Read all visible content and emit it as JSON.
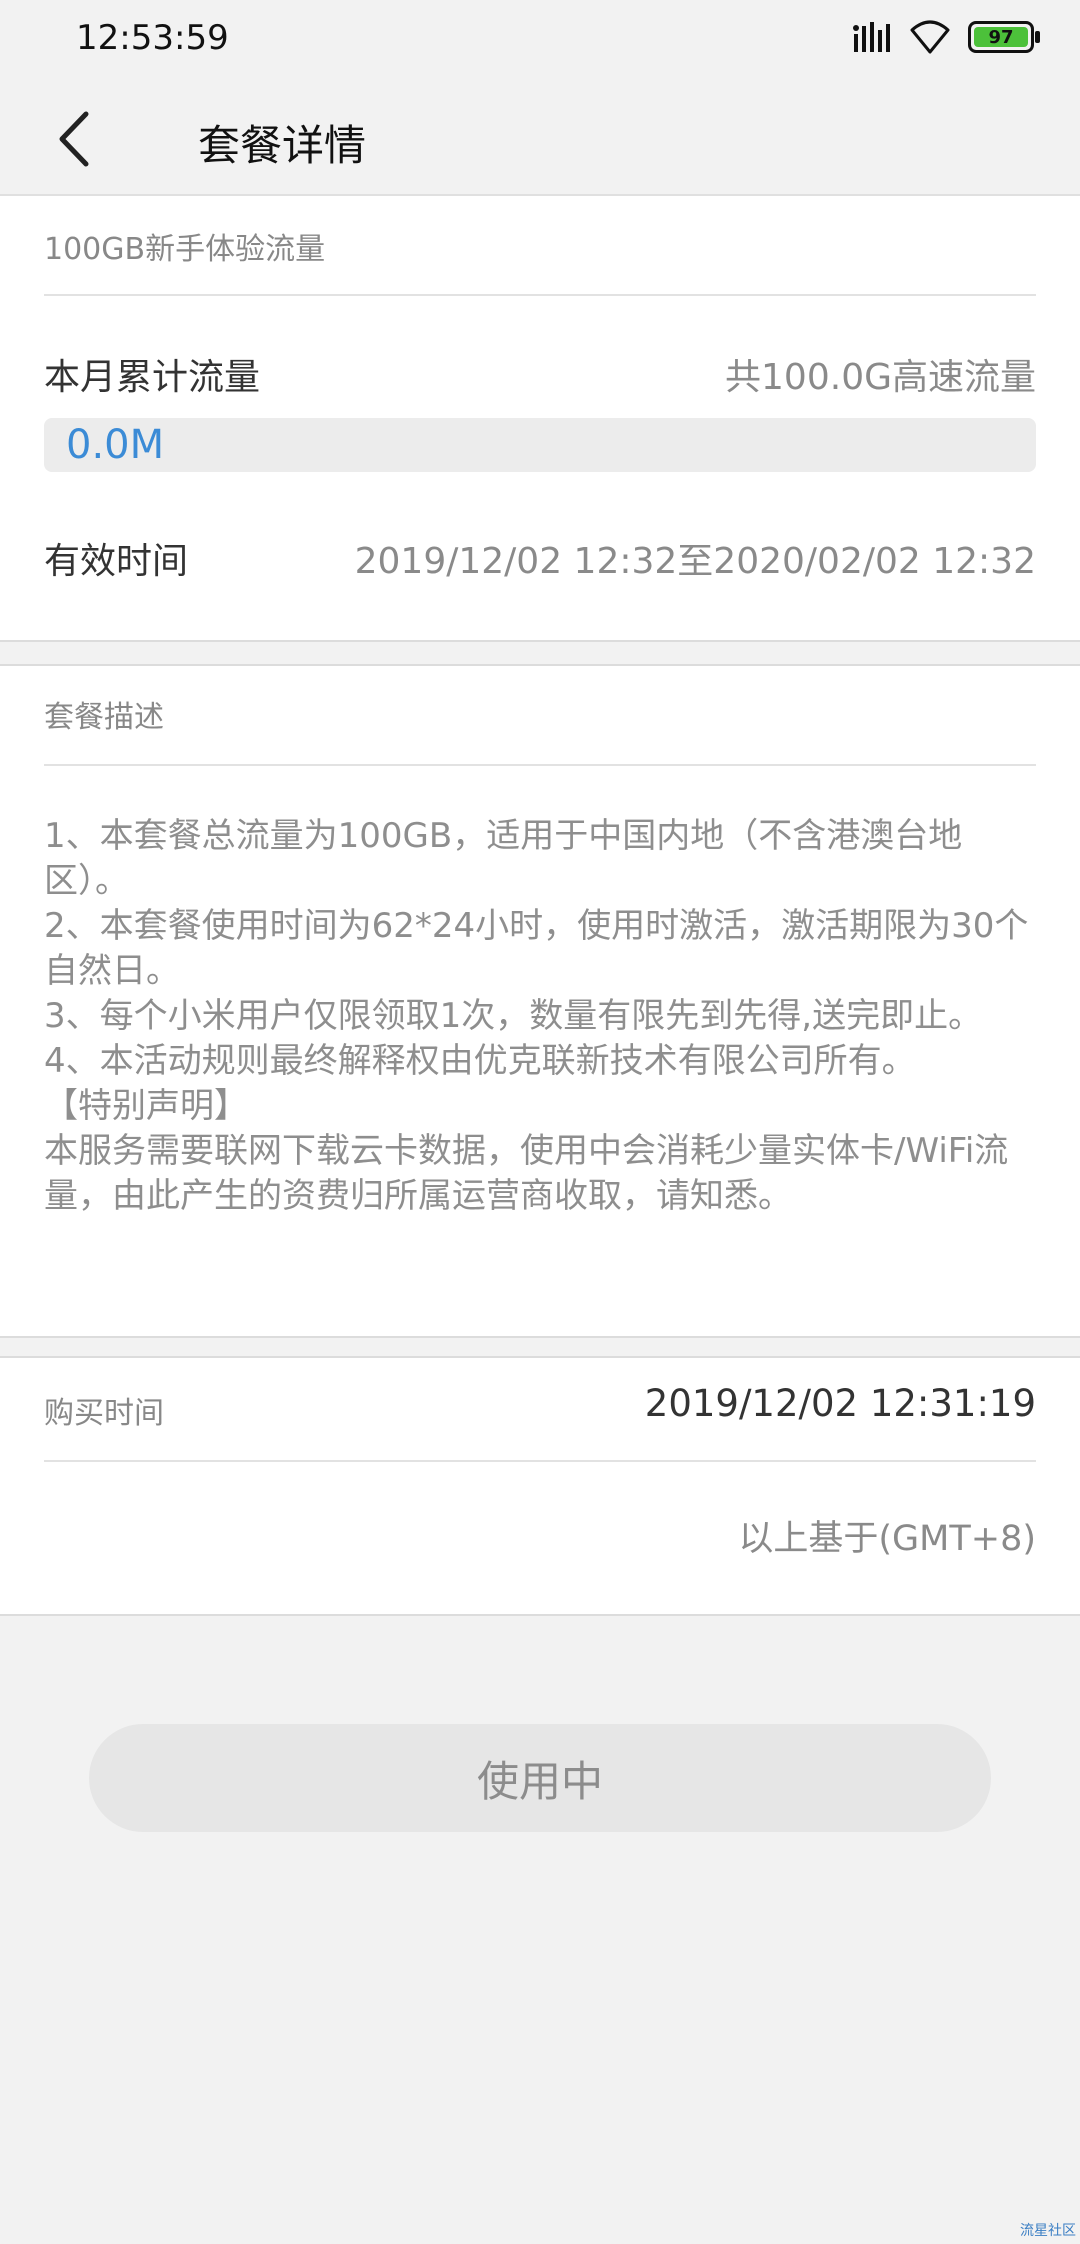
{
  "status_bar": {
    "time": "12:53:59",
    "battery": "97"
  },
  "header": {
    "title": "套餐详情"
  },
  "plan": {
    "name": "100GB新手体验流量",
    "usage_label": "本月累计流量",
    "total_label": "共100.0G高速流量",
    "used_value": "0.0M",
    "used_fraction": 0,
    "valid_label": "有效时间",
    "valid_value": "2019/12/02 12:32至2020/02/02 12:32"
  },
  "description": {
    "title": "套餐描述",
    "body": "1、本套餐总流量为100GB，适用于中国内地（不含港澳台地区）。\n2、本套餐使用时间为62*24小时，使用时激活，激活期限为30个自然日。\n3、每个小米用户仅限领取1次，数量有限先到先得,送完即止。\n4、本活动规则最终解释权由优克联新技术有限公司所有。\n【特别声明】\n本服务需要联网下载云卡数据，使用中会消耗少量实体卡/WiFi流量，由此产生的资费归所属运营商收取，请知悉。"
  },
  "purchase": {
    "label": "购买时间",
    "value": "2019/12/02 12:31:19",
    "timezone_note": "以上基于(GMT+8)"
  },
  "status_button": {
    "label": "使用中"
  },
  "watermark": "流星社区"
}
